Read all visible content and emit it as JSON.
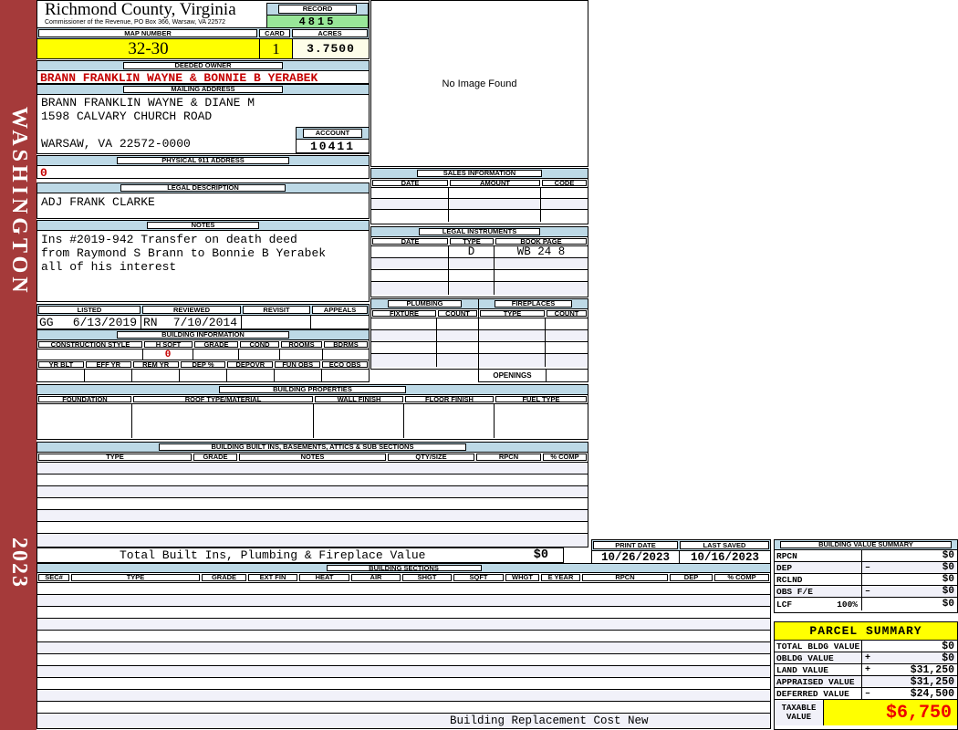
{
  "sidebar": {
    "district": "WASHINGTON",
    "year": "2023"
  },
  "header": {
    "county": "Richmond County, Virginia",
    "subtitle": "Commissioner of the Revenue, PO Box 366, Warsaw, VA 22572",
    "record_label": "RECORD",
    "record_value": "4815",
    "map_number_label": "MAP NUMBER",
    "map_number_value": "32-30",
    "card_label": "CARD",
    "card_value": "1",
    "acres_label": "ACRES",
    "acres_value": "3.7500"
  },
  "owner": {
    "deeded_label": "DEEDED OWNER",
    "deeded_value": "BRANN FRANKLIN WAYNE & BONNIE B YERABEK",
    "mailing_label": "MAILING ADDRESS",
    "mailing_line1": "BRANN FRANKLIN WAYNE & DIANE M",
    "mailing_line2": "1598 CALVARY CHURCH ROAD",
    "mailing_line3": "WARSAW, VA 22572-0000",
    "account_label": "ACCOUNT",
    "account_value": "10411",
    "physical_label": "PHYSICAL 911 ADDRESS",
    "physical_value": "0"
  },
  "legal": {
    "label": "LEGAL DESCRIPTION",
    "value": "ADJ FRANK CLARKE"
  },
  "notes": {
    "label": "NOTES",
    "line1": "Ins #2019-942 Transfer on death deed",
    "line2": "from Raymond S Brann to Bonnie B Yerabek",
    "line3": "all of his interest"
  },
  "review": {
    "columns": [
      "LISTED",
      "REVIEWED",
      "REVISIT",
      "APPEALS"
    ],
    "listed_code": "GG",
    "listed_date": "6/13/2019",
    "reviewed_code": "RN",
    "reviewed_date": "7/10/2014"
  },
  "building_information": {
    "title": "BUILDING INFORMATION",
    "row1_columns": [
      "CONSTRUCTION STYLE",
      "H SQFT",
      "GRADE",
      "COND",
      "ROOMS",
      "BDRMS"
    ],
    "h_sqft_value": "0",
    "row2_columns": [
      "YR BLT",
      "EFF YR",
      "REM YR",
      "DEP %",
      "DEPOVR",
      "FUN OBS",
      "ECO OBS"
    ]
  },
  "no_image_text": "No Image Found",
  "sales": {
    "title": "SALES INFORMATION",
    "columns": [
      "DATE",
      "AMOUNT",
      "CODE"
    ]
  },
  "instruments": {
    "title": "LEGAL INSTRUMENTS",
    "columns": [
      "DATE",
      "TYPE",
      "BOOK PAGE"
    ],
    "row1": {
      "date": "",
      "type": "D",
      "book_page": "WB 24 8"
    }
  },
  "plumbing": {
    "title": "PLUMBING",
    "columns": [
      "FIXTURE",
      "COUNT"
    ]
  },
  "fireplaces": {
    "title": "FIREPLACES",
    "columns": [
      "TYPE",
      "COUNT"
    ],
    "openings_label": "OPENINGS"
  },
  "building_properties": {
    "title": "BUILDING PROPERTIES",
    "columns": [
      "FOUNDATION",
      "ROOF TYPE/MATERIAL",
      "WALL FINISH",
      "FLOOR FINISH",
      "FUEL TYPE"
    ]
  },
  "built_ins": {
    "title": "BUILDING BUILT INS, BASEMENTS, ATTICS & SUB SECTIONS",
    "columns": [
      "TYPE",
      "GRADE",
      "NOTES",
      "QTY/SIZE",
      "RPCN",
      "% COMP"
    ],
    "total_label": "Total Built Ins, Plumbing & Fireplace Value",
    "total_value": "$0"
  },
  "print_info": {
    "print_date_label": "PRINT DATE",
    "print_date": "10/26/2023",
    "last_saved_label": "LAST SAVED",
    "last_saved": "10/16/2023"
  },
  "building_value_summary": {
    "title": "BUILDING VALUE SUMMARY",
    "rows": [
      {
        "label": "RPCN",
        "extra": "",
        "op": "",
        "value": "$0"
      },
      {
        "label": "DEP",
        "extra": "",
        "op": "–",
        "value": "$0"
      },
      {
        "label": "RCLND",
        "extra": "",
        "op": "",
        "value": "$0"
      },
      {
        "label": "OBS F/E",
        "extra": "",
        "op": "–",
        "value": "$0"
      },
      {
        "label": "LCF",
        "extra": "100%",
        "op": "",
        "value": "$0"
      }
    ]
  },
  "building_sections": {
    "title": "BUILDING SECTIONS",
    "columns": [
      "SEC#",
      "TYPE",
      "GRADE",
      "EXT FIN",
      "HEAT",
      "AIR",
      "SHGT",
      "SQFT",
      "WHGT",
      "E YEAR",
      "RPCN",
      "DEP",
      "% COMP"
    ],
    "footer_note": "Building Replacement Cost New"
  },
  "parcel_summary": {
    "title": "PARCEL SUMMARY",
    "rows": [
      {
        "label": "TOTAL BLDG VALUE",
        "op": "",
        "value": "$0"
      },
      {
        "label": "OBLDG VALUE",
        "op": "+",
        "value": "$0"
      },
      {
        "label": "LAND VALUE",
        "op": "+",
        "value": "$31,250"
      },
      {
        "label": "APPRAISED VALUE",
        "op": "",
        "value": "$31,250"
      },
      {
        "label": "DEFERRED VALUE",
        "op": "–",
        "value": "$24,500"
      }
    ],
    "taxable_label_line1": "TAXABLE",
    "taxable_label_line2": "VALUE",
    "taxable_value": "$6,750"
  },
  "colors": {
    "accent_blue": "#bdd9e6",
    "record_green": "#98e698",
    "highlight_yellow": "#ffff00",
    "acres_cream": "#fdfde9",
    "alert_red": "#c40000",
    "spine_red": "#a53a3a"
  }
}
